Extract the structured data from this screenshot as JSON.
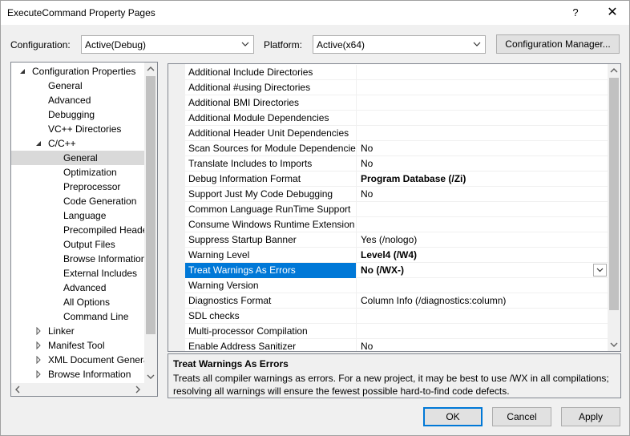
{
  "window": {
    "title": "ExecuteCommand Property Pages",
    "help_glyph": "?",
    "close_glyph": "✕"
  },
  "toolbar": {
    "configuration_label": "Configuration:",
    "configuration_value": "Active(Debug)",
    "platform_label": "Platform:",
    "platform_value": "Active(x64)",
    "config_manager_label": "Configuration Manager..."
  },
  "tree": {
    "items": [
      {
        "label": "Configuration Properties",
        "level": 1,
        "toggle": "expanded"
      },
      {
        "label": "General",
        "level": 2,
        "toggle": "none"
      },
      {
        "label": "Advanced",
        "level": 2,
        "toggle": "none"
      },
      {
        "label": "Debugging",
        "level": 2,
        "toggle": "none"
      },
      {
        "label": "VC++ Directories",
        "level": 2,
        "toggle": "none"
      },
      {
        "label": "C/C++",
        "level": 2,
        "toggle": "expanded"
      },
      {
        "label": "General",
        "level": 3,
        "toggle": "none",
        "selected": true
      },
      {
        "label": "Optimization",
        "level": 3,
        "toggle": "none"
      },
      {
        "label": "Preprocessor",
        "level": 3,
        "toggle": "none"
      },
      {
        "label": "Code Generation",
        "level": 3,
        "toggle": "none"
      },
      {
        "label": "Language",
        "level": 3,
        "toggle": "none"
      },
      {
        "label": "Precompiled Heade",
        "level": 3,
        "toggle": "none"
      },
      {
        "label": "Output Files",
        "level": 3,
        "toggle": "none"
      },
      {
        "label": "Browse Information",
        "level": 3,
        "toggle": "none"
      },
      {
        "label": "External Includes",
        "level": 3,
        "toggle": "none"
      },
      {
        "label": "Advanced",
        "level": 3,
        "toggle": "none"
      },
      {
        "label": "All Options",
        "level": 3,
        "toggle": "none"
      },
      {
        "label": "Command Line",
        "level": 3,
        "toggle": "none"
      },
      {
        "label": "Linker",
        "level": 2,
        "toggle": "collapsed"
      },
      {
        "label": "Manifest Tool",
        "level": 2,
        "toggle": "collapsed"
      },
      {
        "label": "XML Document Genera",
        "level": 2,
        "toggle": "collapsed"
      },
      {
        "label": "Browse Information",
        "level": 2,
        "toggle": "collapsed"
      }
    ]
  },
  "grid": {
    "rows": [
      {
        "name": "Additional Include Directories",
        "value": "",
        "bold": false
      },
      {
        "name": "Additional #using Directories",
        "value": "",
        "bold": false
      },
      {
        "name": "Additional BMI Directories",
        "value": "",
        "bold": false
      },
      {
        "name": "Additional Module Dependencies",
        "value": "",
        "bold": false
      },
      {
        "name": "Additional Header Unit Dependencies",
        "value": "",
        "bold": false
      },
      {
        "name": "Scan Sources for Module Dependencies",
        "value": "No",
        "bold": false
      },
      {
        "name": "Translate Includes to Imports",
        "value": "No",
        "bold": false
      },
      {
        "name": "Debug Information Format",
        "value": "Program Database (/Zi)",
        "bold": true
      },
      {
        "name": "Support Just My Code Debugging",
        "value": "No",
        "bold": false
      },
      {
        "name": "Common Language RunTime Support",
        "value": "",
        "bold": false
      },
      {
        "name": "Consume Windows Runtime Extension",
        "value": "",
        "bold": false
      },
      {
        "name": "Suppress Startup Banner",
        "value": "Yes (/nologo)",
        "bold": false
      },
      {
        "name": "Warning Level",
        "value": "Level4 (/W4)",
        "bold": true
      },
      {
        "name": "Treat Warnings As Errors",
        "value": "No (/WX-)",
        "bold": true,
        "selected": true
      },
      {
        "name": "Warning Version",
        "value": "",
        "bold": false
      },
      {
        "name": "Diagnostics Format",
        "value": "Column Info (/diagnostics:column)",
        "bold": false
      },
      {
        "name": "SDL checks",
        "value": "",
        "bold": false
      },
      {
        "name": "Multi-processor Compilation",
        "value": "",
        "bold": false
      },
      {
        "name": "Enable Address Sanitizer",
        "value": "No",
        "bold": false
      }
    ]
  },
  "description": {
    "title": "Treat Warnings As Errors",
    "text": "Treats all compiler warnings as errors. For a new project, it may be best to use /WX in all compilations; resolving all warnings will ensure the fewest possible hard-to-find code defects."
  },
  "buttons": {
    "ok": "OK",
    "cancel": "Cancel",
    "apply": "Apply"
  },
  "colors": {
    "selection_blue": "#0078d7",
    "tree_selection": "#cce8ff",
    "dialog_bg": "#f0f0f0"
  }
}
